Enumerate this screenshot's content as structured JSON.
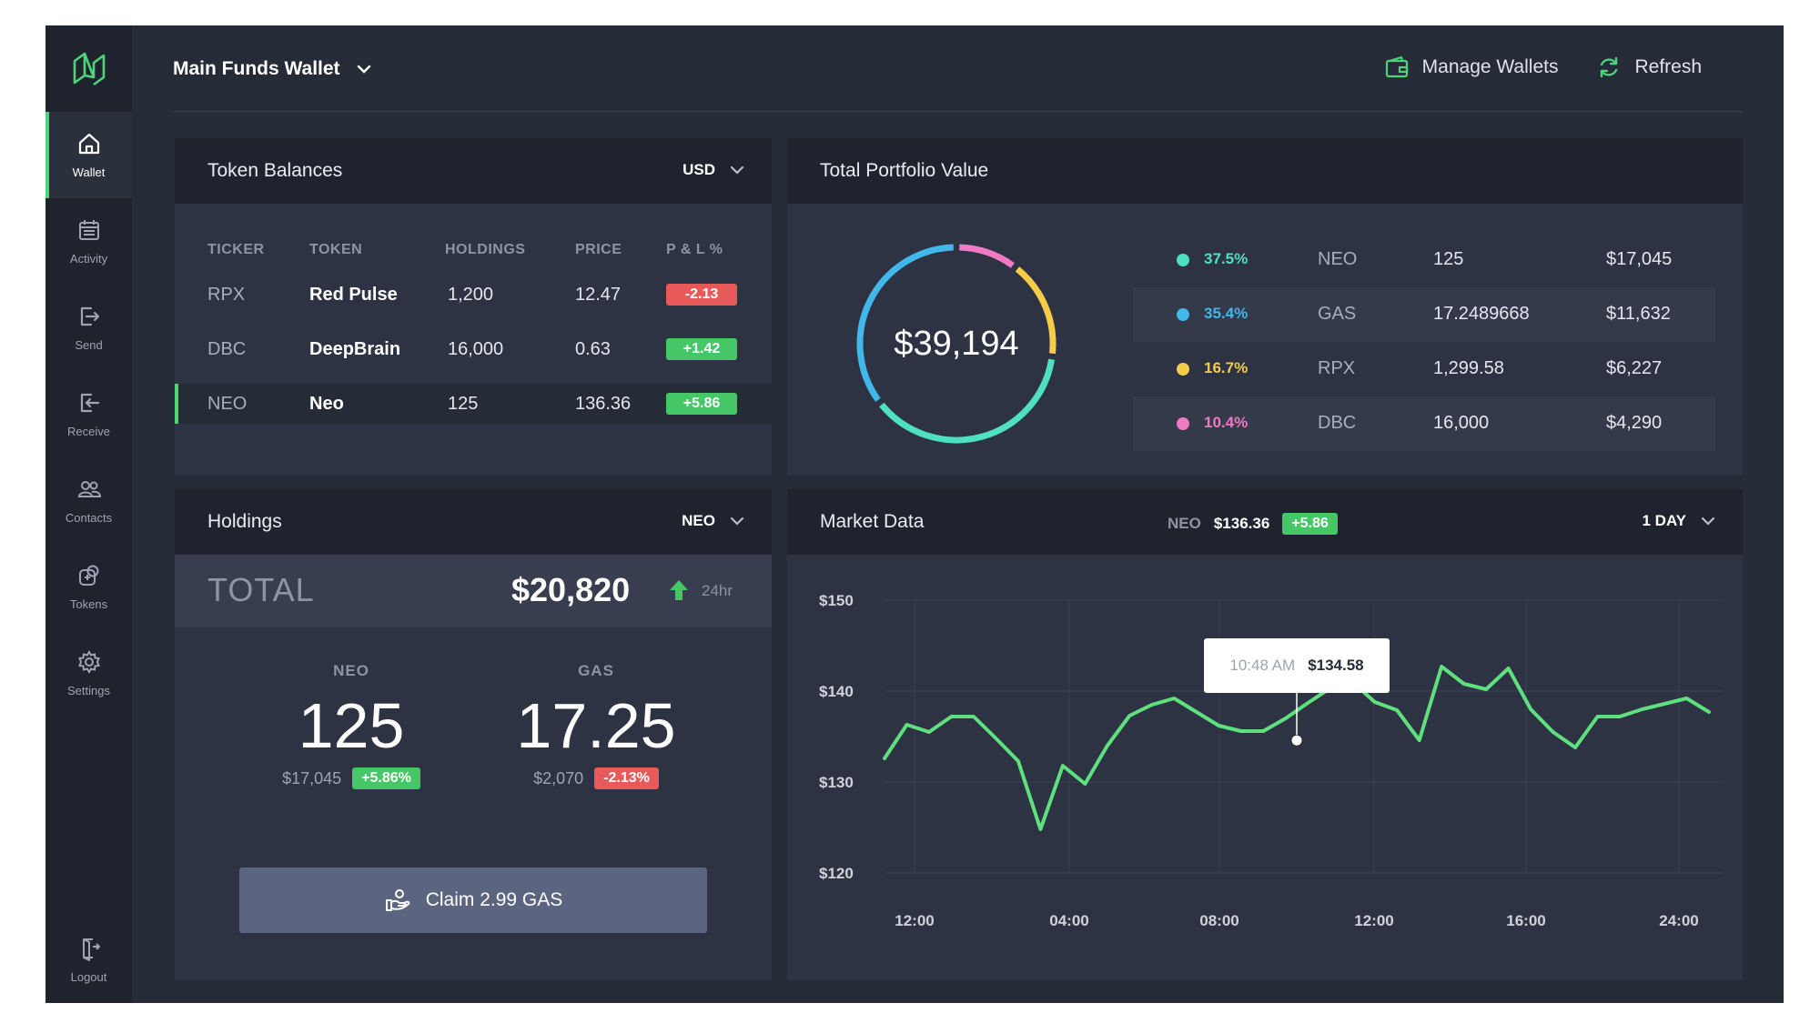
{
  "sidebar": {
    "items": [
      {
        "label": "Wallet",
        "icon": "home-icon"
      },
      {
        "label": "Activity",
        "icon": "calendar-icon"
      },
      {
        "label": "Send",
        "icon": "send-icon"
      },
      {
        "label": "Receive",
        "icon": "receive-icon"
      },
      {
        "label": "Contacts",
        "icon": "contacts-icon"
      },
      {
        "label": "Tokens",
        "icon": "tokens-icon"
      },
      {
        "label": "Settings",
        "icon": "gear-icon"
      }
    ],
    "logout": "Logout"
  },
  "header": {
    "wallet": "Main Funds Wallet",
    "manage": "Manage Wallets",
    "refresh": "Refresh"
  },
  "balances": {
    "title": "Token Balances",
    "currency": "USD",
    "columns": [
      "TICKER",
      "TOKEN",
      "HOLDINGS",
      "PRICE",
      "P & L %"
    ],
    "rows": [
      {
        "ticker": "RPX",
        "token": "Red Pulse",
        "holdings": "1,200",
        "price": "12.47",
        "pl": "-2.13"
      },
      {
        "ticker": "DBC",
        "token": "DeepBrain",
        "holdings": "16,000",
        "price": "0.63",
        "pl": "+1.42"
      },
      {
        "ticker": "NEO",
        "token": "Neo",
        "holdings": "125",
        "price": "136.36",
        "pl": "+5.86"
      }
    ]
  },
  "portfolio": {
    "title": "Total Portfolio Value",
    "total": "$39,194",
    "rows": [
      {
        "pct": "37.5%",
        "name": "NEO",
        "amount": "125",
        "value": "$17,045",
        "color": "#4fe0c3"
      },
      {
        "pct": "35.4%",
        "name": "GAS",
        "amount": "17.2489668",
        "value": "$11,632",
        "color": "#42b7ea"
      },
      {
        "pct": "16.7%",
        "name": "RPX",
        "amount": "1,299.58",
        "value": "$6,227",
        "color": "#f5cc45"
      },
      {
        "pct": "10.4%",
        "name": "DBC",
        "amount": "16,000",
        "value": "$4,290",
        "color": "#f07ac3"
      }
    ]
  },
  "holdings": {
    "title": "Holdings",
    "token": "NEO",
    "total_label": "TOTAL",
    "total_value": "$20,820",
    "period": "24hr",
    "neo": {
      "symbol": "NEO",
      "amount": "125",
      "usd": "$17,045",
      "change": "+5.86%"
    },
    "gas": {
      "symbol": "GAS",
      "amount": "17.25",
      "usd": "$2,070",
      "change": "-2.13%"
    },
    "claim": "Claim 2.99 GAS"
  },
  "market": {
    "title": "Market Data",
    "symbol": "NEO",
    "price": "$136.36",
    "change": "+5.86",
    "period": "1 DAY",
    "tooltip_time": "10:48 AM",
    "tooltip_value": "$134.58"
  },
  "chart_data": {
    "type": "line",
    "x_ticks": [
      "12:00",
      "04:00",
      "08:00",
      "12:00",
      "16:00",
      "24:00"
    ],
    "y_ticks": [
      "$150",
      "$140",
      "$130",
      "$120"
    ],
    "ylim": [
      120,
      150
    ],
    "series": [
      {
        "color": "#5ee07e",
        "values": [
          132.6,
          136.3,
          135.5,
          137.2,
          137.2,
          134.8,
          132.3,
          124.8,
          131.8,
          129.8,
          134.0,
          137.3,
          138.5,
          139.2,
          137.7,
          136.2,
          135.6,
          135.6,
          137.0,
          138.7,
          140.3,
          141.0,
          138.8,
          137.9,
          134.6,
          142.7,
          140.8,
          140.2,
          142.5,
          138.0,
          135.5,
          133.8,
          137.2,
          137.2,
          138.0,
          138.6,
          139.2,
          137.7
        ]
      }
    ]
  }
}
